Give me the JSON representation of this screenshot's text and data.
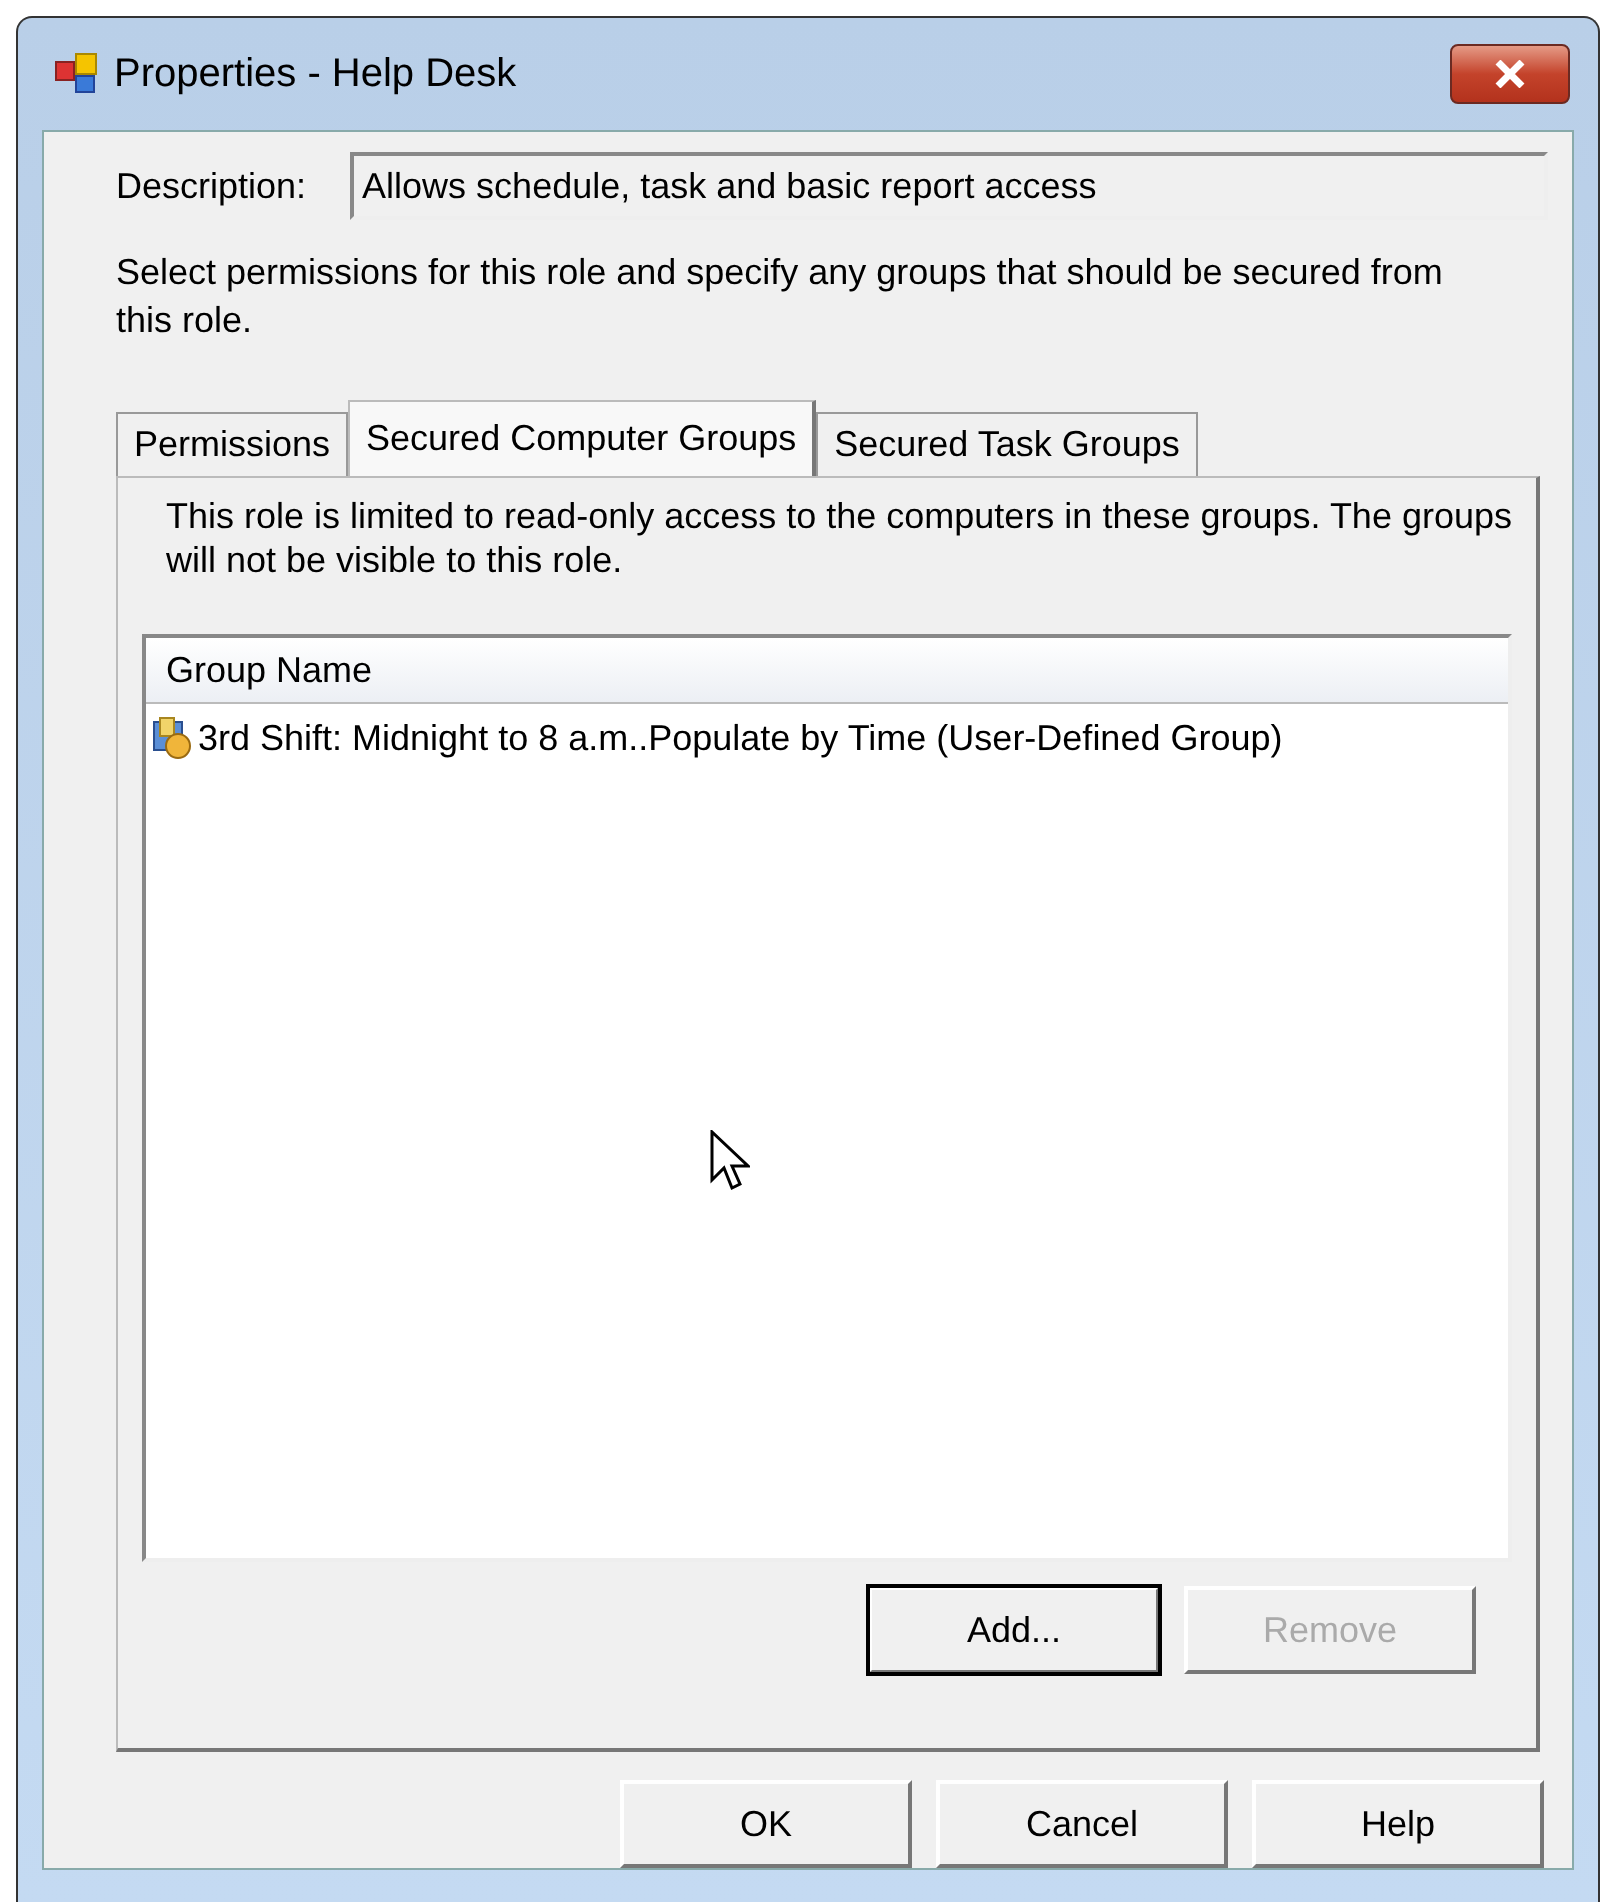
{
  "window": {
    "title": "Properties - Help Desk"
  },
  "description": {
    "label": "Description:",
    "value": "Allows schedule, task and basic report access"
  },
  "instructions": "Select permissions for this role and specify any groups that should be secured from this role.",
  "tabs": [
    {
      "label": "Permissions",
      "selected": false
    },
    {
      "label": "Secured Computer Groups",
      "selected": true
    },
    {
      "label": "Secured Task Groups",
      "selected": false
    }
  ],
  "panel": {
    "note": "This role is limited to read-only access to the computers in these groups. The groups will not be visible to this role.",
    "list": {
      "columns": [
        "Group Name"
      ],
      "rows": [
        {
          "name": "3rd Shift:  Midnight to 8 a.m..Populate by Time (User-Defined Group)",
          "selected": false
        }
      ]
    },
    "buttons": [
      {
        "label": "Add...",
        "disabled": false,
        "focused": true
      },
      {
        "label": "Remove",
        "disabled": true,
        "focused": false
      }
    ]
  },
  "buttons": [
    {
      "label": "OK",
      "disabled": false
    },
    {
      "label": "Cancel",
      "disabled": false
    },
    {
      "label": "Help",
      "disabled": false
    }
  ]
}
